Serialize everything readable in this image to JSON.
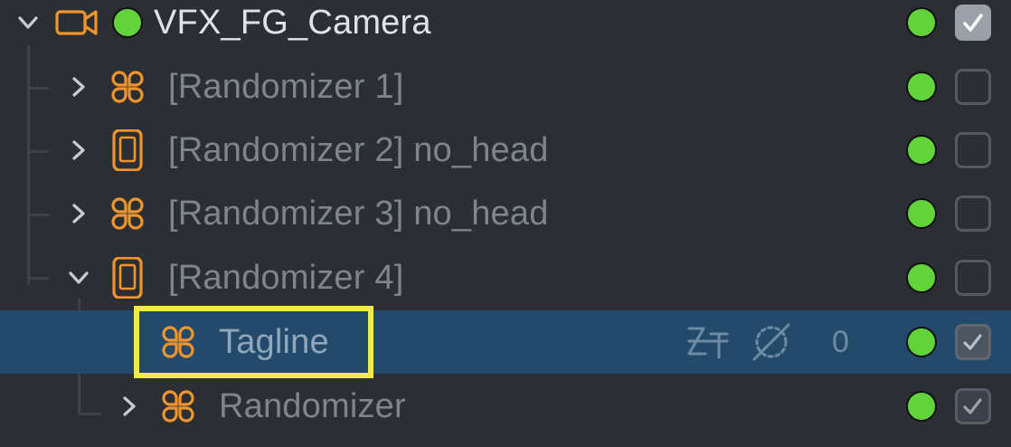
{
  "hierarchy": {
    "root": {
      "label": "VFX_FG_Camera",
      "icon": "camera-icon",
      "expanded": true,
      "active": true,
      "status_color": "#63d33c",
      "checked": true
    },
    "items": [
      {
        "label": "[Randomizer 1]",
        "icon": "randomizer-icon",
        "expanded": false,
        "enabled": false,
        "checked": false
      },
      {
        "label": "[Randomizer 2] no_head",
        "icon": "device-icon",
        "expanded": false,
        "enabled": false,
        "checked": false
      },
      {
        "label": "[Randomizer 3] no_head",
        "icon": "randomizer-icon",
        "expanded": false,
        "enabled": false,
        "checked": false
      },
      {
        "label": "[Randomizer 4]",
        "icon": "device-icon",
        "expanded": true,
        "enabled": false,
        "checked": false
      },
      {
        "label": "Tagline",
        "icon": "randomizer-icon",
        "selected": true,
        "count": "0",
        "checked": true
      },
      {
        "label": "Randomizer",
        "icon": "randomizer-icon",
        "expanded": false,
        "checked": true
      }
    ]
  },
  "colors": {
    "background": "#2b2e33",
    "selection": "#234a6b",
    "icon_orange": "#f0952e",
    "status_green": "#63d33c",
    "highlight_yellow": "#f2e94a"
  }
}
